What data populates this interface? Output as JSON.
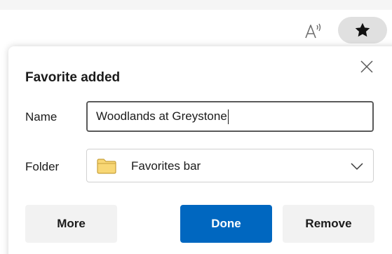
{
  "toolbar": {
    "read_aloud_icon": "read-aloud-icon",
    "favorite_icon": "star-filled-icon"
  },
  "dialog": {
    "title": "Favorite added",
    "close_icon": "close-icon",
    "name_label": "Name",
    "name_value": "Woodlands at Greystone",
    "folder_label": "Folder",
    "folder_icon": "folder-icon",
    "folder_value": "Favorites bar",
    "dropdown_icon": "chevron-down-icon",
    "buttons": {
      "more": "More",
      "done": "Done",
      "remove": "Remove"
    }
  },
  "colors": {
    "accent": "#0067c0",
    "folder_fill": "#f8d775",
    "folder_stroke": "#c8a13a",
    "secondary_button": "#f2f2f2",
    "star_button_bg": "#e0e0e0"
  }
}
